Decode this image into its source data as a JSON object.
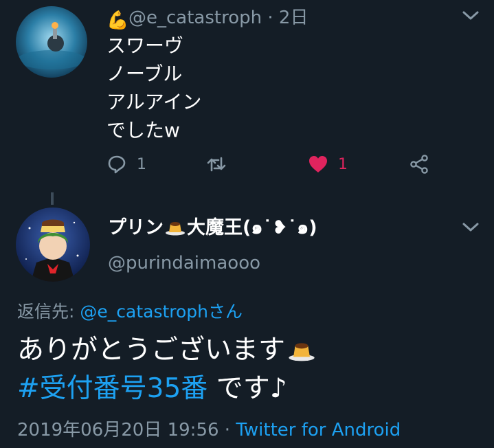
{
  "tweet1": {
    "avatar_alt": "avatar",
    "emoji": "💪",
    "handle": "@e_catastroph",
    "separator": " · ",
    "time": "2日",
    "lines": [
      "スワーヴ",
      "ノーブル",
      "アルアイン",
      "でしたw"
    ],
    "reply_count": "1",
    "retweet_count": "",
    "like_count": "1"
  },
  "tweet2": {
    "display_name_part1": "プリン",
    "display_name_part2": "大魔王(๑˙❥˙๑)",
    "handle": "@purindaimaooo",
    "replying_label": "返信先: ",
    "replying_handle": "@e_catastroph",
    "replying_suffix": "さん",
    "text_line1": "ありがとうございます",
    "hashtag": "#受付番号35番",
    "text_line2_rest": " です♪",
    "timestamp": "2019年06月20日 19:56",
    "meta_separator": " · ",
    "source": "Twitter for Android"
  },
  "colors": {
    "background": "#141d26",
    "link": "#1da1f2",
    "muted": "#8899a6",
    "like": "#e0245e"
  }
}
